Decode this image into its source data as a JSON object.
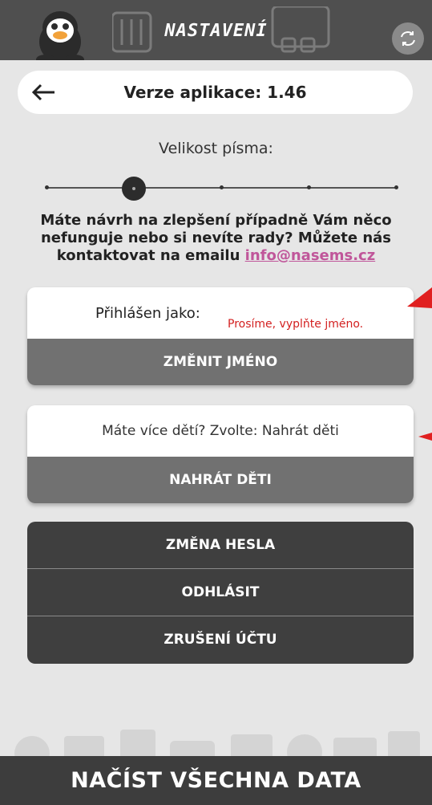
{
  "header": {
    "title": "NASTAVENÍ",
    "mascot_icon": "penguin-avatar",
    "sync_icon": "sync-icon"
  },
  "version_bar": {
    "back_icon": "arrow-left-icon",
    "text": "Verze aplikace: 1.46"
  },
  "font_size": {
    "label": "Velikost písma:",
    "steps": 5,
    "selected_index": 1
  },
  "feedback": {
    "text": "Máte návrh na zlepšení případně Vám něco nefunguje nebo si nevíte rady? Můžete nás kontaktovat na emailu",
    "email": "info@nasems.cz"
  },
  "login_card": {
    "label": "Přihlášen jako:",
    "warning": "Prosíme, vyplňte jméno.",
    "button": "ZMĚNIT JMÉNO"
  },
  "children_card": {
    "text": "Máte více dětí? Zvolte: Nahrát děti",
    "button": "NAHRÁT DĚTI"
  },
  "account_menu": [
    {
      "label": "ZMĚNA HESLA"
    },
    {
      "label": "ODHLÁSIT"
    },
    {
      "label": "ZRUŠENÍ ÚČTU"
    }
  ],
  "bottom_button": "NAČÍST VŠECHNA DATA",
  "colors": {
    "background": "#e6e6e6",
    "header": "#4f4f4f",
    "card_button": "#717171",
    "dark_menu": "#3f3f3f",
    "bottom_bar": "#3d3d3d",
    "email_link": "#c0569a",
    "warning": "#d32020"
  }
}
